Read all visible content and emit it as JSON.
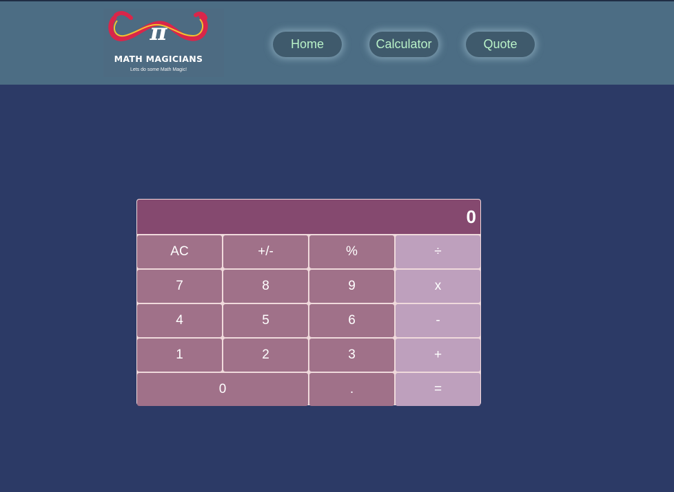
{
  "brand": {
    "title": "MATH MAGICIANS",
    "tagline": "Lets do some Math Magic!",
    "logo_symbol": "π",
    "colors": {
      "ribbon_red": "#d9264a",
      "ribbon_yellow": "#f2c230"
    }
  },
  "nav": {
    "items": [
      {
        "label": "Home"
      },
      {
        "label": "Calculator"
      },
      {
        "label": "Quote"
      }
    ]
  },
  "calculator": {
    "display": "0",
    "keys": {
      "ac": "AC",
      "sign": "+/-",
      "percent": "%",
      "divide": "÷",
      "seven": "7",
      "eight": "8",
      "nine": "9",
      "multiply": "x",
      "four": "4",
      "five": "5",
      "six": "6",
      "subtract": "-",
      "one": "1",
      "two": "2",
      "three": "3",
      "add": "+",
      "zero": "0",
      "decimal": ".",
      "equals": "="
    }
  },
  "colors": {
    "page_bg": "#2c3a66",
    "header_bg": "#4c6d84",
    "nav_text": "#b9f2c8",
    "display_bg": "#85496f",
    "key_bg": "#a07189",
    "operator_bg": "#bea0bd"
  }
}
